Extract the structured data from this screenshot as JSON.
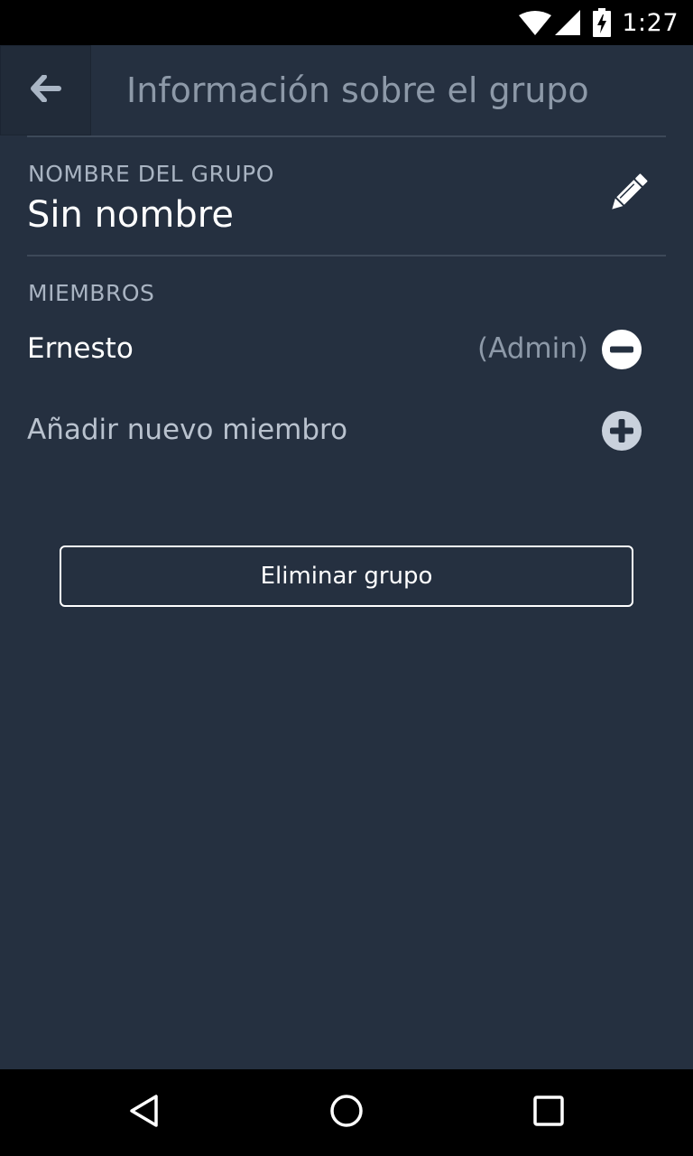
{
  "status_bar": {
    "time": "1:27",
    "icons": [
      "wifi-icon",
      "cell-signal-icon",
      "battery-charging-icon"
    ]
  },
  "app_bar": {
    "back_icon": "arrow-left-icon",
    "title": "Información sobre el grupo"
  },
  "group_name_section": {
    "label": "NOMBRE DEL GRUPO",
    "value": "Sin nombre",
    "edit_icon": "pencil-icon"
  },
  "members_section": {
    "label": "MIEMBROS",
    "members": [
      {
        "name": "Ernesto",
        "role": "(Admin)",
        "action_icon": "minus-circle-icon"
      }
    ],
    "add_label": "Añadir nuevo miembro",
    "add_icon": "plus-circle-icon"
  },
  "actions": {
    "delete_group_label": "Eliminar grupo"
  },
  "nav_bar": {
    "icons": [
      "back-triangle-icon",
      "home-circle-icon",
      "recents-square-icon"
    ]
  },
  "colors": {
    "background": "#253040",
    "title_text": "#8d99a8",
    "divider": "#3d4959",
    "add_icon": "#c9d1dc"
  }
}
